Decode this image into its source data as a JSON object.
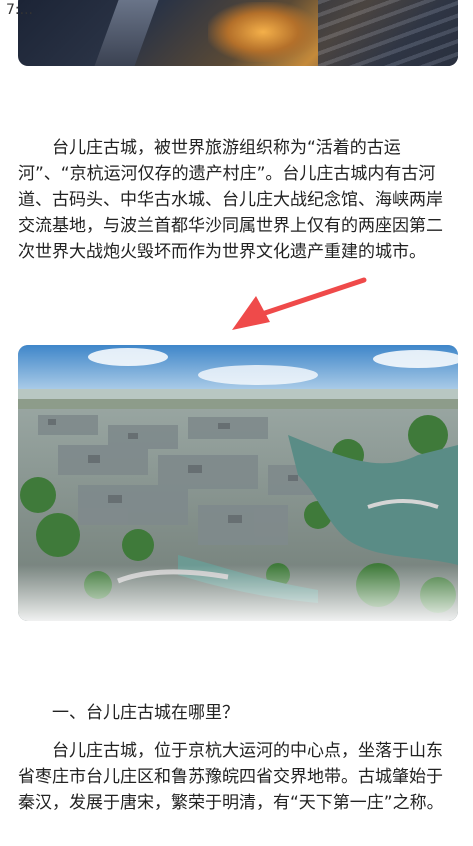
{
  "status_bar": {
    "time": "7:..."
  },
  "images": {
    "top": "night-view-of-ancient-town",
    "main": "aerial-view-of-taierzhuang-ancient-town"
  },
  "annotation": {
    "arrow_color": "#ef4a4a",
    "arrow_icon": "red-arrow-icon"
  },
  "article": {
    "paragraph1": "台儿庄古城，被世界旅游组织称为“活着的古运河”、“京杭运河仅存的遗产村庄”。台儿庄古城内有古河道、古码头、中华古水城、台儿庄大战纪念馆、海峡两岸交流基地，与波兰首都华沙同属世界上仅有的两座因第二次世界大战炮火毁坏而作为世界文化遗产重建的城市。",
    "heading1": "一、台儿庄古城在哪里？",
    "paragraph2": "台儿庄古城，位于京杭大运河的中心点，坐落于山东省枣庄市台儿庄区和鲁苏豫皖四省交界地带。古城肇始于秦汉，发展于唐宋，繁荣于明清，有“天下第一庄”之称。"
  }
}
